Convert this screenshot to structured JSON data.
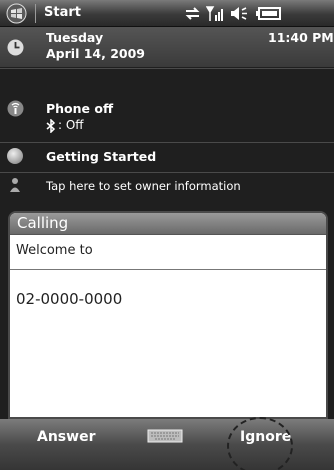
{
  "titlebar": {
    "title": "Start",
    "time": "11:40 PM"
  },
  "today": {
    "date_line1": "Tuesday",
    "date_line2": "April 14, 2009",
    "phone_title": "Phone off",
    "phone_status": ": Off",
    "getting_started": "Getting Started",
    "owner_info": "Tap here to set owner information"
  },
  "dialog": {
    "title": "Calling",
    "message": "Welcome to",
    "number": "02-0000-0000"
  },
  "softkeys": {
    "left": "Answer",
    "right": "Ignore"
  },
  "icons": [
    "windows-logo-icon",
    "connectivity-icon",
    "signal-icon",
    "volume-icon",
    "battery-icon",
    "clock-icon",
    "phone-icon",
    "bluetooth-icon",
    "getting-started-icon",
    "owner-icon",
    "keyboard-icon"
  ]
}
